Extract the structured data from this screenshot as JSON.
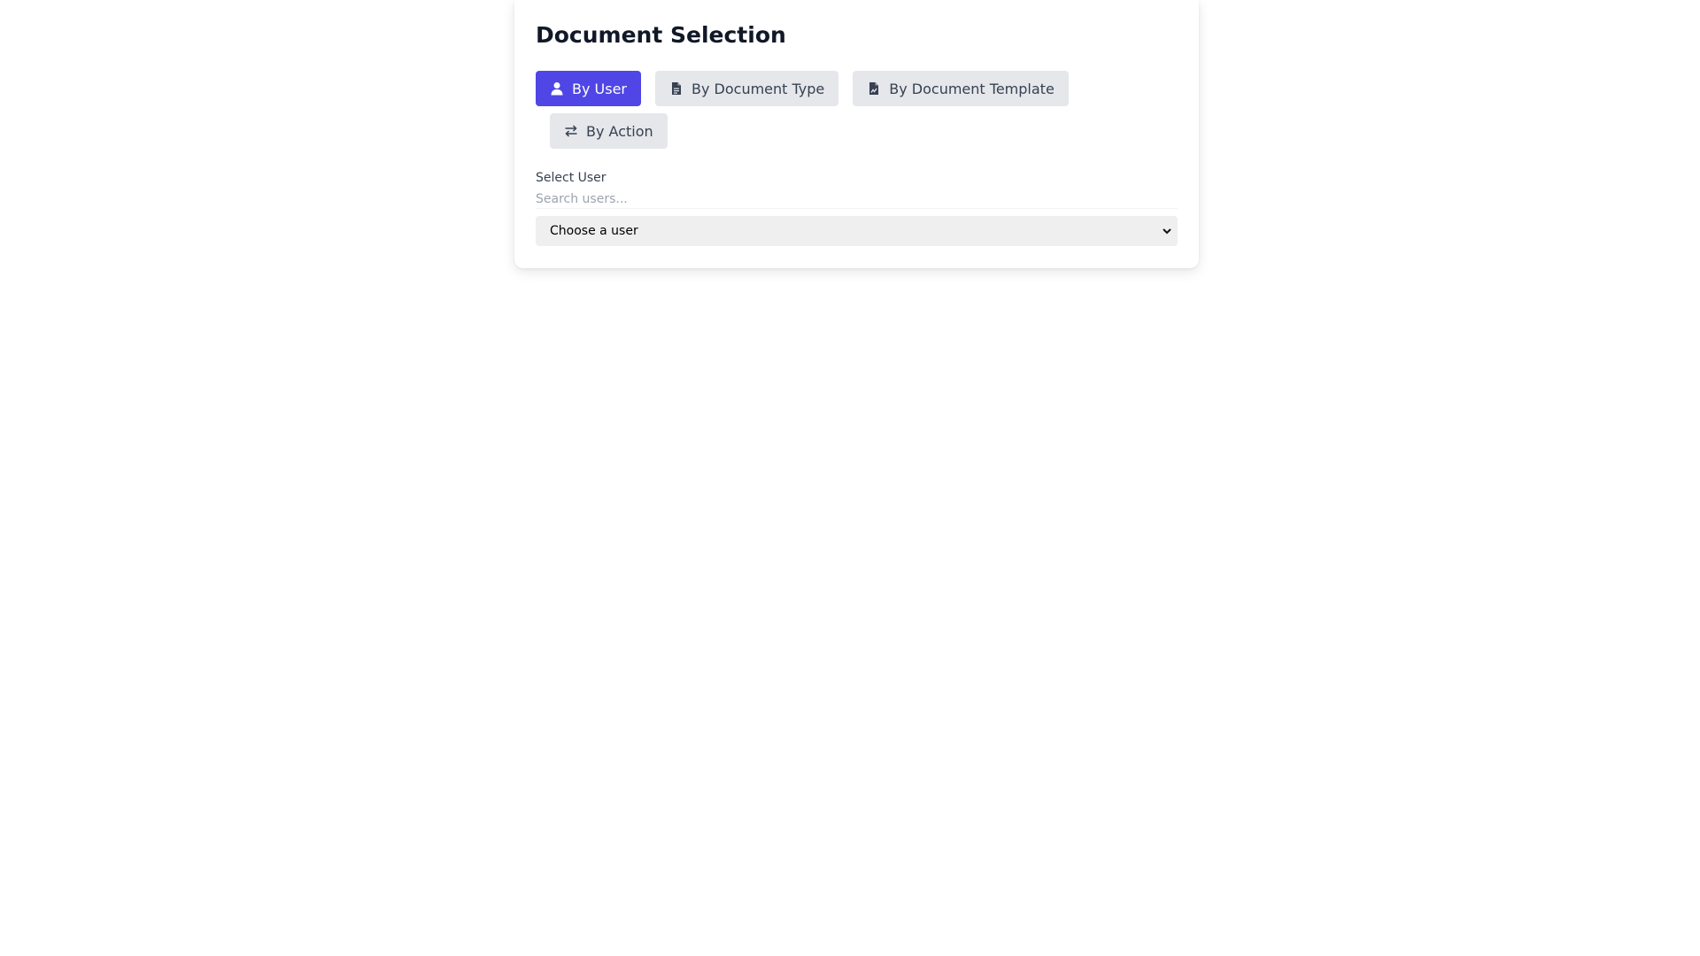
{
  "title": "Document Selection",
  "tabs": [
    {
      "label": "By User",
      "icon": "user-icon",
      "active": true
    },
    {
      "label": "By Document Type",
      "icon": "file-lines-icon",
      "active": false
    },
    {
      "label": "By Document Template",
      "icon": "file-signature-icon",
      "active": false
    },
    {
      "label": "By Action",
      "icon": "exchange-arrows-icon",
      "active": false
    }
  ],
  "select_user": {
    "label": "Select User",
    "search_placeholder": "Search users...",
    "dropdown_value": "Choose a user"
  },
  "colors": {
    "accent": "#4f46e5",
    "tab_bg": "#e5e7eb",
    "title": "#111827"
  }
}
